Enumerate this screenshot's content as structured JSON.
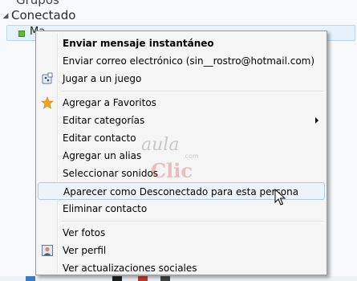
{
  "contact_list": {
    "previous_group": "Grupos",
    "group_name": "Conectado",
    "selected_contact": "Ma"
  },
  "menu": {
    "items": [
      {
        "label": "Enviar mensaje instantáneo"
      },
      {
        "label": "Enviar correo electrónico (sin__rostro@hotmail.com)"
      },
      {
        "label": "Jugar a un juego",
        "icon": "game-icon"
      },
      {
        "label": "Agregar a Favoritos",
        "icon": "star-icon"
      },
      {
        "label": "Editar categorías",
        "submenu": true
      },
      {
        "label": "Editar contacto"
      },
      {
        "label": "Agregar un alias"
      },
      {
        "label": "Seleccionar sonidos"
      },
      {
        "label": "Aparecer como Desconectado para esta persona"
      },
      {
        "label": "Eliminar contacto"
      },
      {
        "label": "Ver fotos"
      },
      {
        "label": "Ver perfil",
        "icon": "profile-icon"
      },
      {
        "label": "Ver actualizaciones sociales"
      }
    ],
    "hovered_item": "Aparecer como Desconectado para esta persona"
  },
  "watermark": {
    "line1": "aula",
    "line2": ".com",
    "line3": "Clic"
  },
  "colors": {
    "menu_background": "#f5f5f5",
    "hover_background": "#eef3fa",
    "hover_border": "#aecbe7",
    "status_online": "#5bbd35",
    "star": "#f3a51c"
  }
}
